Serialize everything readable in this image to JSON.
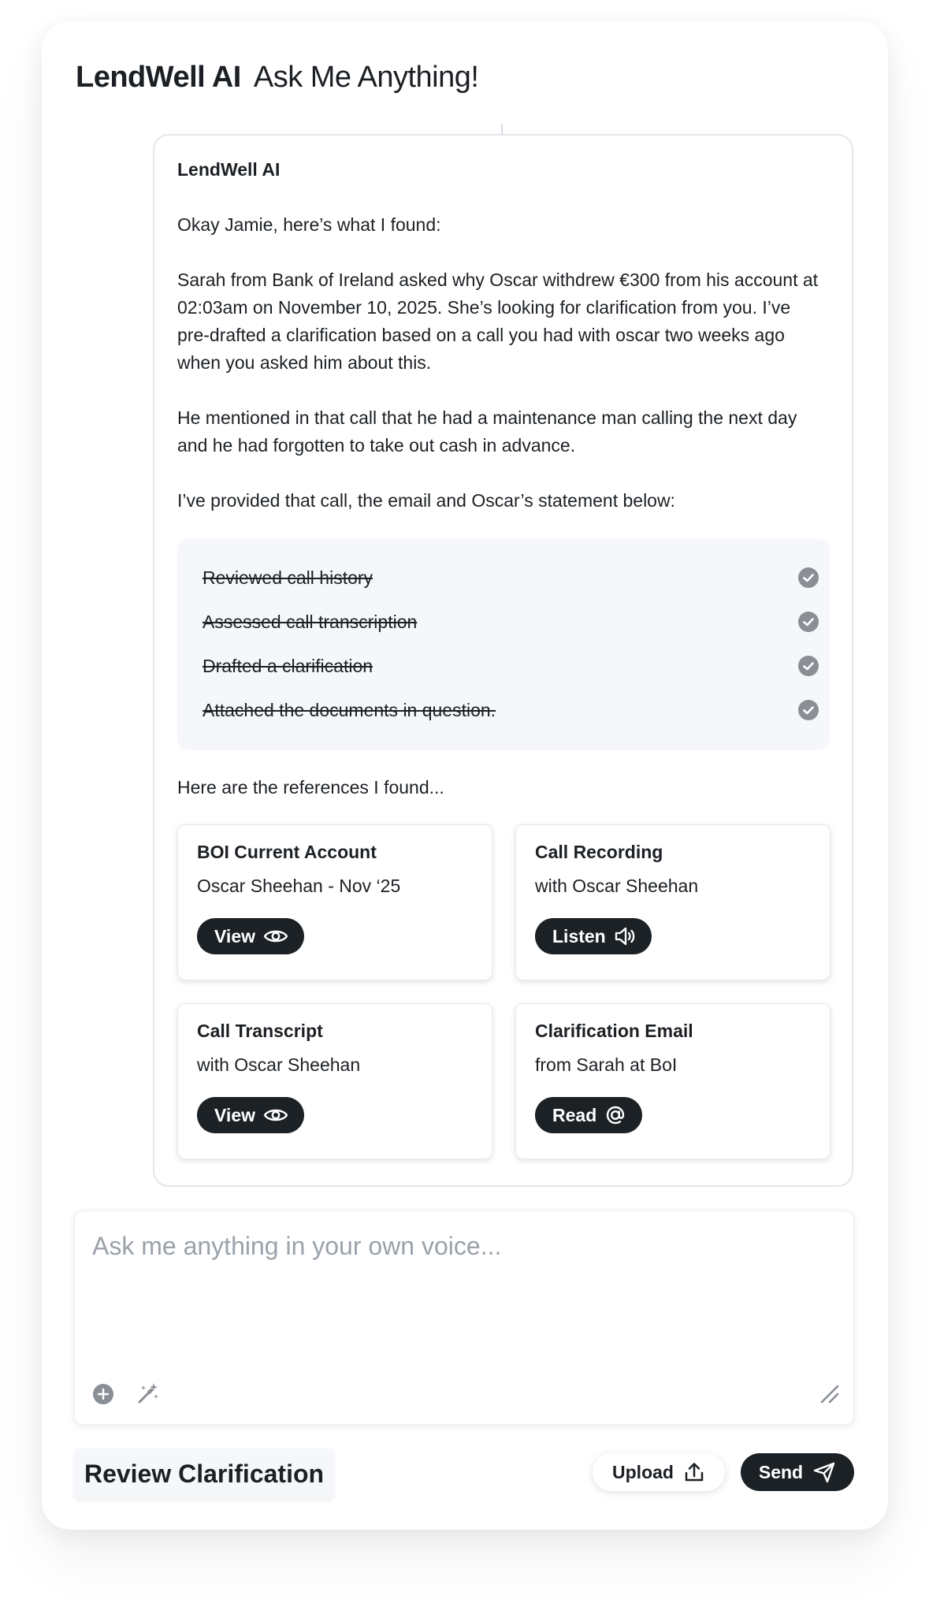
{
  "header": {
    "brand": "LendWell AI",
    "subtitle": "Ask Me Anything!"
  },
  "message": {
    "author": "LendWell AI",
    "paragraphs": [
      "Okay Jamie, here’s what I found:",
      "Sarah from Bank of Ireland asked why Oscar withdrew €300 from his account at 02:03am on November 10, 2025. She’s looking for clarification from you. I’ve pre-drafted a clarification based on a call you had with oscar two weeks ago when you asked him about this.",
      "He mentioned in that call that he had a maintenance man calling the next day and he had forgotten to take out cash in advance.",
      "I’ve provided that call, the email and Oscar’s statement below:"
    ],
    "checklist": [
      {
        "label": "Reviewed call history",
        "status": "done",
        "icon": "check-circle-icon"
      },
      {
        "label": "Assessed call transcription",
        "status": "done",
        "icon": "check-circle-icon"
      },
      {
        "label": "Drafted a clarification",
        "status": "done",
        "icon": "check-circle-icon"
      },
      {
        "label": "Attached the documents in question.",
        "status": "done",
        "icon": "check-circle-icon"
      }
    ],
    "references_intro": "Here are the references I found...",
    "references": [
      {
        "title": "BOI Current Account",
        "subtitle": "Oscar Sheehan - Nov ‘25",
        "action": "View",
        "icon": "eye-icon"
      },
      {
        "title": "Call Recording",
        "subtitle": "with Oscar Sheehan",
        "action": "Listen",
        "icon": "speaker-icon"
      },
      {
        "title": "Call Transcript",
        "subtitle": "with Oscar Sheehan",
        "action": "View",
        "icon": "eye-icon"
      },
      {
        "title": "Clarification Email",
        "subtitle": "from Sarah at BoI",
        "action": "Read",
        "icon": "at-sign-icon"
      }
    ]
  },
  "composer": {
    "placeholder": "Ask me anything in your own voice...",
    "icons": [
      "plus-circle-icon",
      "magic-wand-icon",
      "resize-handle-icon"
    ]
  },
  "footer": {
    "review_label": "Review Clarification",
    "upload_label": "Upload",
    "send_label": "Send"
  },
  "colors": {
    "dark_pill": "#1c2126",
    "check_grey": "#8a8f96",
    "panel_bg": "#f5f7fa",
    "placeholder": "#9aa1a9"
  }
}
